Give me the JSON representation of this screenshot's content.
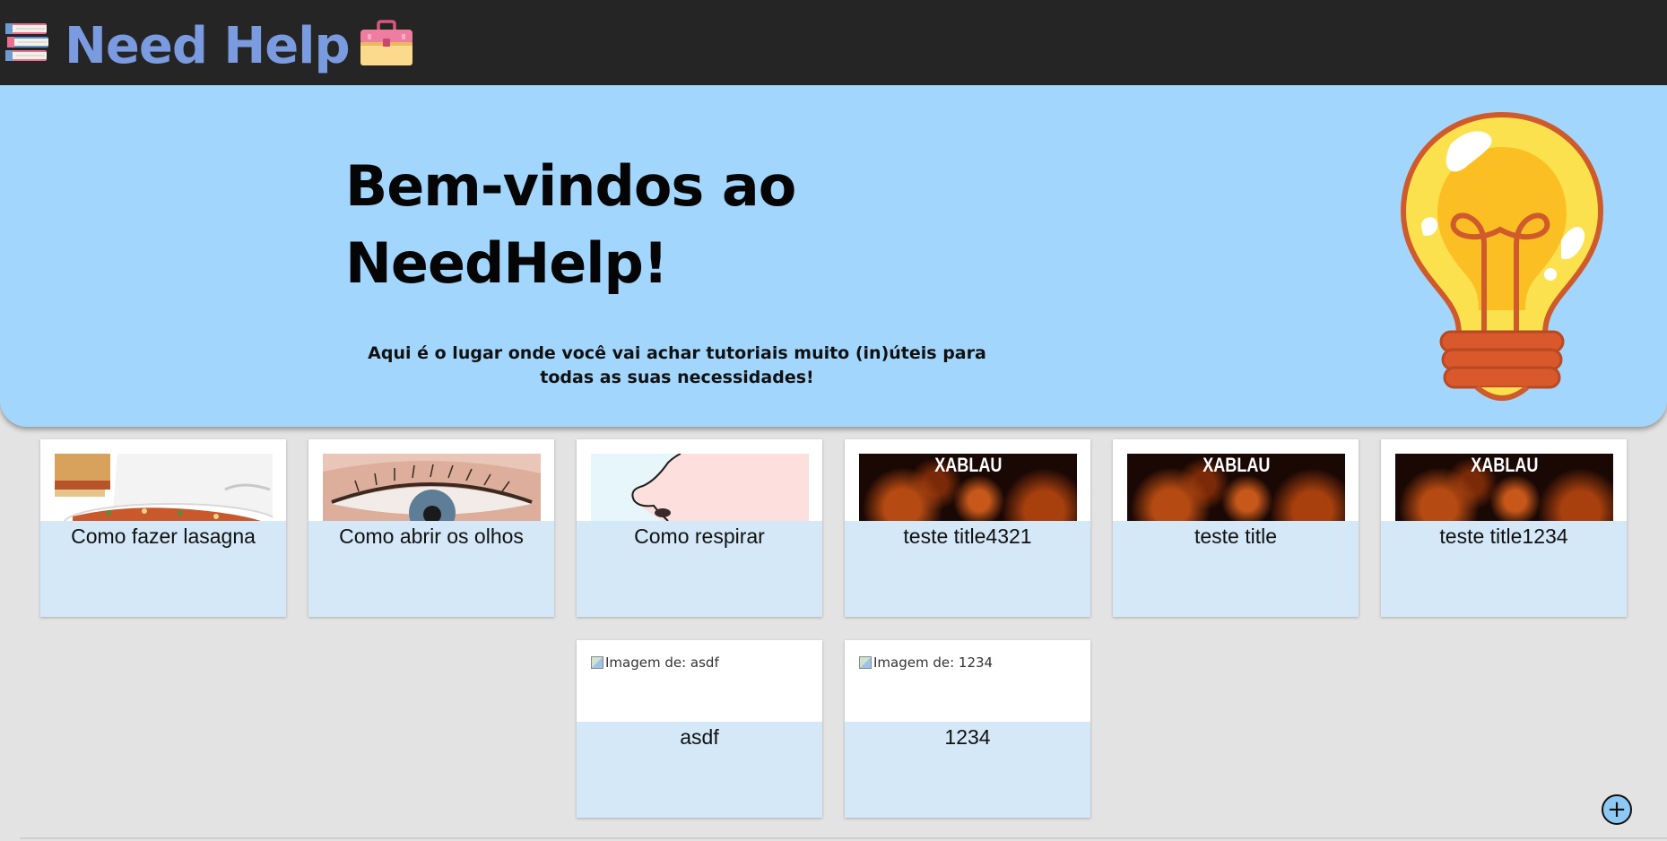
{
  "header": {
    "brand_text": "Need Help",
    "left_icon": "books-icon",
    "right_icon": "toolbox-icon",
    "colors": {
      "background": "#252525",
      "brand": "#7b9be0"
    }
  },
  "hero": {
    "title": "Bem-vindos ao NeedHelp!",
    "subtitle": "Aqui é o lugar onde você vai achar tutoriais muito (in)úteis para todas as suas necessidades!",
    "illustration": "lightbulb-icon",
    "background": "#a3d6fd"
  },
  "tutorials": [
    {
      "title": "Como fazer lasagna",
      "image": "lasagna"
    },
    {
      "title": "Como abrir os olhos",
      "image": "eye"
    },
    {
      "title": "Como respirar",
      "image": "nose"
    },
    {
      "title": "teste title4321",
      "image": "xablau",
      "image_text": "XABLAU"
    },
    {
      "title": "teste title",
      "image": "xablau",
      "image_text": "XABLAU"
    },
    {
      "title": "teste title1234",
      "image": "xablau",
      "image_text": "XABLAU"
    },
    {
      "title": "asdf",
      "image_alt": "Imagem de: asdf"
    },
    {
      "title": "1234",
      "image_alt": "Imagem de: 1234"
    }
  ],
  "add_button": {
    "label": "+",
    "icon": "plus-icon"
  }
}
